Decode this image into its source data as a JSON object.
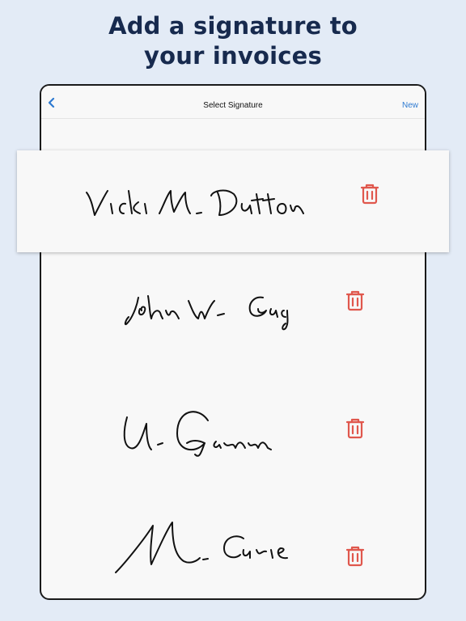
{
  "headline": {
    "line1": "Add a signature to",
    "line2": "your invoices"
  },
  "navbar": {
    "back_icon": "chevron-left-icon",
    "title": "Select Signature",
    "new_label": "New"
  },
  "signatures": [
    {
      "name": "Vicki M. Dutton",
      "delete_icon": "trash-icon"
    },
    {
      "name": "John W. Gacy",
      "delete_icon": "trash-icon"
    },
    {
      "name": "U. Gamm",
      "delete_icon": "trash-icon"
    },
    {
      "name": "M. Curie",
      "delete_icon": "trash-icon"
    }
  ],
  "colors": {
    "background": "#e3ebf6",
    "headline": "#172a4e",
    "accent": "#2e7ad1",
    "delete": "#e0574d"
  }
}
